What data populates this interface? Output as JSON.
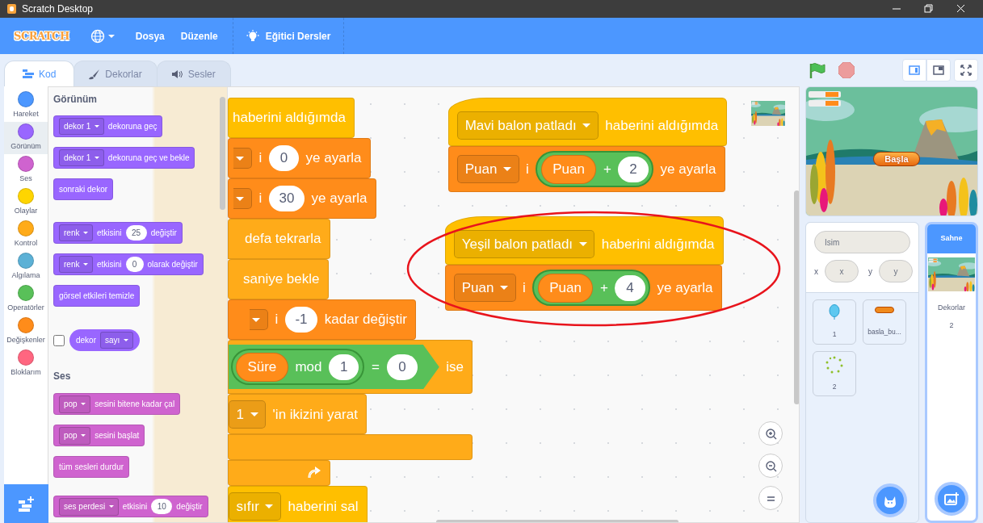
{
  "window": {
    "title": "Scratch Desktop"
  },
  "menu": {
    "logo": "SCRATCH",
    "items": [
      {
        "label": "Dosya"
      },
      {
        "label": "Düzenle"
      }
    ],
    "tutorials": "Eğitici Dersler"
  },
  "tabs": [
    {
      "label": "Kod",
      "selected": true
    },
    {
      "label": "Dekorlar",
      "selected": false
    },
    {
      "label": "Sesler",
      "selected": false
    }
  ],
  "categories": [
    {
      "label": "Hareket",
      "color": "#4c97ff",
      "selected": false
    },
    {
      "label": "Görünüm",
      "color": "#9966ff",
      "selected": true
    },
    {
      "label": "Ses",
      "color": "#cf63cf",
      "selected": false
    },
    {
      "label": "Olaylar",
      "color": "#ffd500",
      "selected": false
    },
    {
      "label": "Kontrol",
      "color": "#ffab19",
      "selected": false
    },
    {
      "label": "Algılama",
      "color": "#5cb1d6",
      "selected": false
    },
    {
      "label": "Operatörler",
      "color": "#59c059",
      "selected": false
    },
    {
      "label": "Değişkenler",
      "color": "#ff8c1a",
      "selected": false
    },
    {
      "label": "Bloklarım",
      "color": "#ff6680",
      "selected": false
    }
  ],
  "palette": [
    {
      "kind": "heading",
      "text": "Görünüm"
    },
    {
      "kind": "block",
      "color": "#9966ff",
      "parts": [
        {
          "kind": "dropdown",
          "text": "dekor 1"
        },
        {
          "kind": "label",
          "text": "dekoruna geç"
        }
      ]
    },
    {
      "kind": "block",
      "color": "#9966ff",
      "parts": [
        {
          "kind": "dropdown",
          "text": "dekor 1"
        },
        {
          "kind": "label",
          "text": "dekoruna geç ve bekle"
        }
      ]
    },
    {
      "kind": "block",
      "color": "#9966ff",
      "parts": [
        {
          "kind": "label",
          "text": "sonraki dekor"
        }
      ]
    },
    {
      "kind": "block",
      "color": "#9966ff",
      "parts": [
        {
          "kind": "dropdown",
          "text": "renk"
        },
        {
          "kind": "label",
          "text": "etkisini"
        },
        {
          "kind": "number",
          "text": "25"
        },
        {
          "kind": "label",
          "text": "değiştir"
        }
      ]
    },
    {
      "kind": "block",
      "color": "#9966ff",
      "parts": [
        {
          "kind": "dropdown",
          "text": "renk"
        },
        {
          "kind": "label",
          "text": "etkisini"
        },
        {
          "kind": "number",
          "text": "0"
        },
        {
          "kind": "label",
          "text": "olarak değiştir"
        }
      ]
    },
    {
      "kind": "block",
      "color": "#9966ff",
      "parts": [
        {
          "kind": "label",
          "text": "görsel etkileri temizle"
        }
      ]
    },
    {
      "kind": "reporter",
      "color": "#9966ff",
      "checked": false,
      "parts": [
        {
          "kind": "label",
          "text": "dekor"
        },
        {
          "kind": "dropdown",
          "text": "sayı"
        }
      ]
    },
    {
      "kind": "heading",
      "text": "Ses"
    },
    {
      "kind": "block",
      "color": "#cf63cf",
      "parts": [
        {
          "kind": "dropdown",
          "text": "pop"
        },
        {
          "kind": "label",
          "text": "sesini bitene kadar çal"
        }
      ]
    },
    {
      "kind": "block",
      "color": "#cf63cf",
      "parts": [
        {
          "kind": "dropdown",
          "text": "pop"
        },
        {
          "kind": "label",
          "text": "sesini başlat"
        }
      ]
    },
    {
      "kind": "block",
      "color": "#cf63cf",
      "parts": [
        {
          "kind": "label",
          "text": "tüm sesleri durdur"
        }
      ]
    },
    {
      "kind": "block",
      "color": "#cf63cf",
      "parts": [
        {
          "kind": "dropdown",
          "text": "ses perdesi"
        },
        {
          "kind": "label",
          "text": "etkisini"
        },
        {
          "kind": "number",
          "text": "10"
        },
        {
          "kind": "label",
          "text": "değiştir"
        }
      ]
    }
  ],
  "scripts": [
    {
      "circled": false,
      "blocks": [
        {
          "kind": "stack",
          "color": "#ffbf00",
          "parts": [
            {
              "kind": "label",
              "text": "haberini aldığımda"
            }
          ]
        },
        {
          "kind": "stack",
          "color": "#ff8c1a",
          "parts": [
            {
              "kind": "caret"
            },
            {
              "kind": "label",
              "text": "i"
            },
            {
              "kind": "number",
              "text": "0"
            },
            {
              "kind": "label",
              "text": "ye ayarla"
            }
          ]
        },
        {
          "kind": "stack",
          "color": "#ff8c1a",
          "parts": [
            {
              "kind": "caret"
            },
            {
              "kind": "label",
              "text": "i"
            },
            {
              "kind": "number",
              "text": "30"
            },
            {
              "kind": "label",
              "text": "ye ayarla"
            }
          ]
        },
        {
          "kind": "wrap",
          "loop": true,
          "color": "#ffab19",
          "parts": [
            {
              "kind": "label",
              "text": "defa tekrarla"
            }
          ],
          "children": [
            {
              "kind": "stack",
              "color": "#ffab19",
              "parts": [
                {
                  "kind": "label",
                  "text": "saniye bekle"
                }
              ]
            },
            {
              "kind": "stack",
              "color": "#ff8c1a",
              "parts": [
                {
                  "kind": "caret"
                },
                {
                  "kind": "label",
                  "text": "i"
                },
                {
                  "kind": "number",
                  "text": "-1"
                },
                {
                  "kind": "label",
                  "text": "kadar değiştir"
                }
              ]
            },
            {
              "kind": "wrap",
              "loop": false,
              "color": "#ffab19",
              "parts": [
                {
                  "kind": "condition",
                  "parts": [
                    {
                      "kind": "operator",
                      "parts": [
                        {
                          "kind": "reporter",
                          "color": "#ff8c1a",
                          "text": "Süre"
                        },
                        {
                          "kind": "label",
                          "text": "mod"
                        },
                        {
                          "kind": "number",
                          "text": "1"
                        }
                      ]
                    },
                    {
                      "kind": "label",
                      "text": "="
                    },
                    {
                      "kind": "number",
                      "text": "0"
                    }
                  ]
                },
                {
                  "kind": "label",
                  "text": "ise"
                }
              ],
              "children": [
                {
                  "kind": "stack",
                  "color": "#ffab19",
                  "parts": [
                    {
                      "kind": "dropdown",
                      "text": "1"
                    },
                    {
                      "kind": "label",
                      "text": "'in ikizini yarat"
                    }
                  ]
                }
              ]
            }
          ]
        },
        {
          "kind": "stack",
          "color": "#ffbf00",
          "parts": [
            {
              "kind": "dropdown",
              "text": "sıfır"
            },
            {
              "kind": "label",
              "text": "haberini sal"
            }
          ]
        }
      ]
    },
    {
      "circled": false,
      "blocks": [
        {
          "kind": "hat",
          "color": "#ffbf00",
          "parts": [
            {
              "kind": "dropdown",
              "text": "Mavi balon patladı"
            },
            {
              "kind": "label",
              "text": "haberini aldığımda"
            }
          ]
        },
        {
          "kind": "stack",
          "color": "#ff8c1a",
          "parts": [
            {
              "kind": "dropdown",
              "text": "Puan"
            },
            {
              "kind": "label",
              "text": "i"
            },
            {
              "kind": "operator",
              "parts": [
                {
                  "kind": "reporter",
                  "color": "#ff8c1a",
                  "text": "Puan"
                },
                {
                  "kind": "label",
                  "text": "+"
                },
                {
                  "kind": "number",
                  "text": "2"
                }
              ]
            },
            {
              "kind": "label",
              "text": "ye ayarla"
            }
          ]
        }
      ]
    },
    {
      "circled": true,
      "blocks": [
        {
          "kind": "hat",
          "color": "#ffbf00",
          "parts": [
            {
              "kind": "dropdown",
              "text": "Yeşil balon patladı"
            },
            {
              "kind": "label",
              "text": "haberini aldığımda"
            }
          ]
        },
        {
          "kind": "stack",
          "color": "#ff8c1a",
          "parts": [
            {
              "kind": "dropdown",
              "text": "Puan"
            },
            {
              "kind": "label",
              "text": "i"
            },
            {
              "kind": "operator",
              "parts": [
                {
                  "kind": "reporter",
                  "color": "#ff8c1a",
                  "text": "Puan"
                },
                {
                  "kind": "label",
                  "text": "+"
                },
                {
                  "kind": "number",
                  "text": "4"
                }
              ]
            },
            {
              "kind": "label",
              "text": "ye ayarla"
            }
          ]
        }
      ]
    }
  ],
  "stage": {
    "sprite_label": "Başla"
  },
  "sprite_info": {
    "name_placeholder": "İsim",
    "x_label": "x",
    "x_placeholder": "x",
    "y_label": "y",
    "y_placeholder": "y"
  },
  "sprites": [
    {
      "name": "1",
      "kind": "balloon"
    },
    {
      "name": "basla_bu...",
      "kind": "pill"
    },
    {
      "name": "2",
      "kind": "ring"
    }
  ],
  "stage_pane": {
    "title": "Sahne",
    "backdrops_label": "Dekorlar",
    "backdrops_count": "2"
  }
}
